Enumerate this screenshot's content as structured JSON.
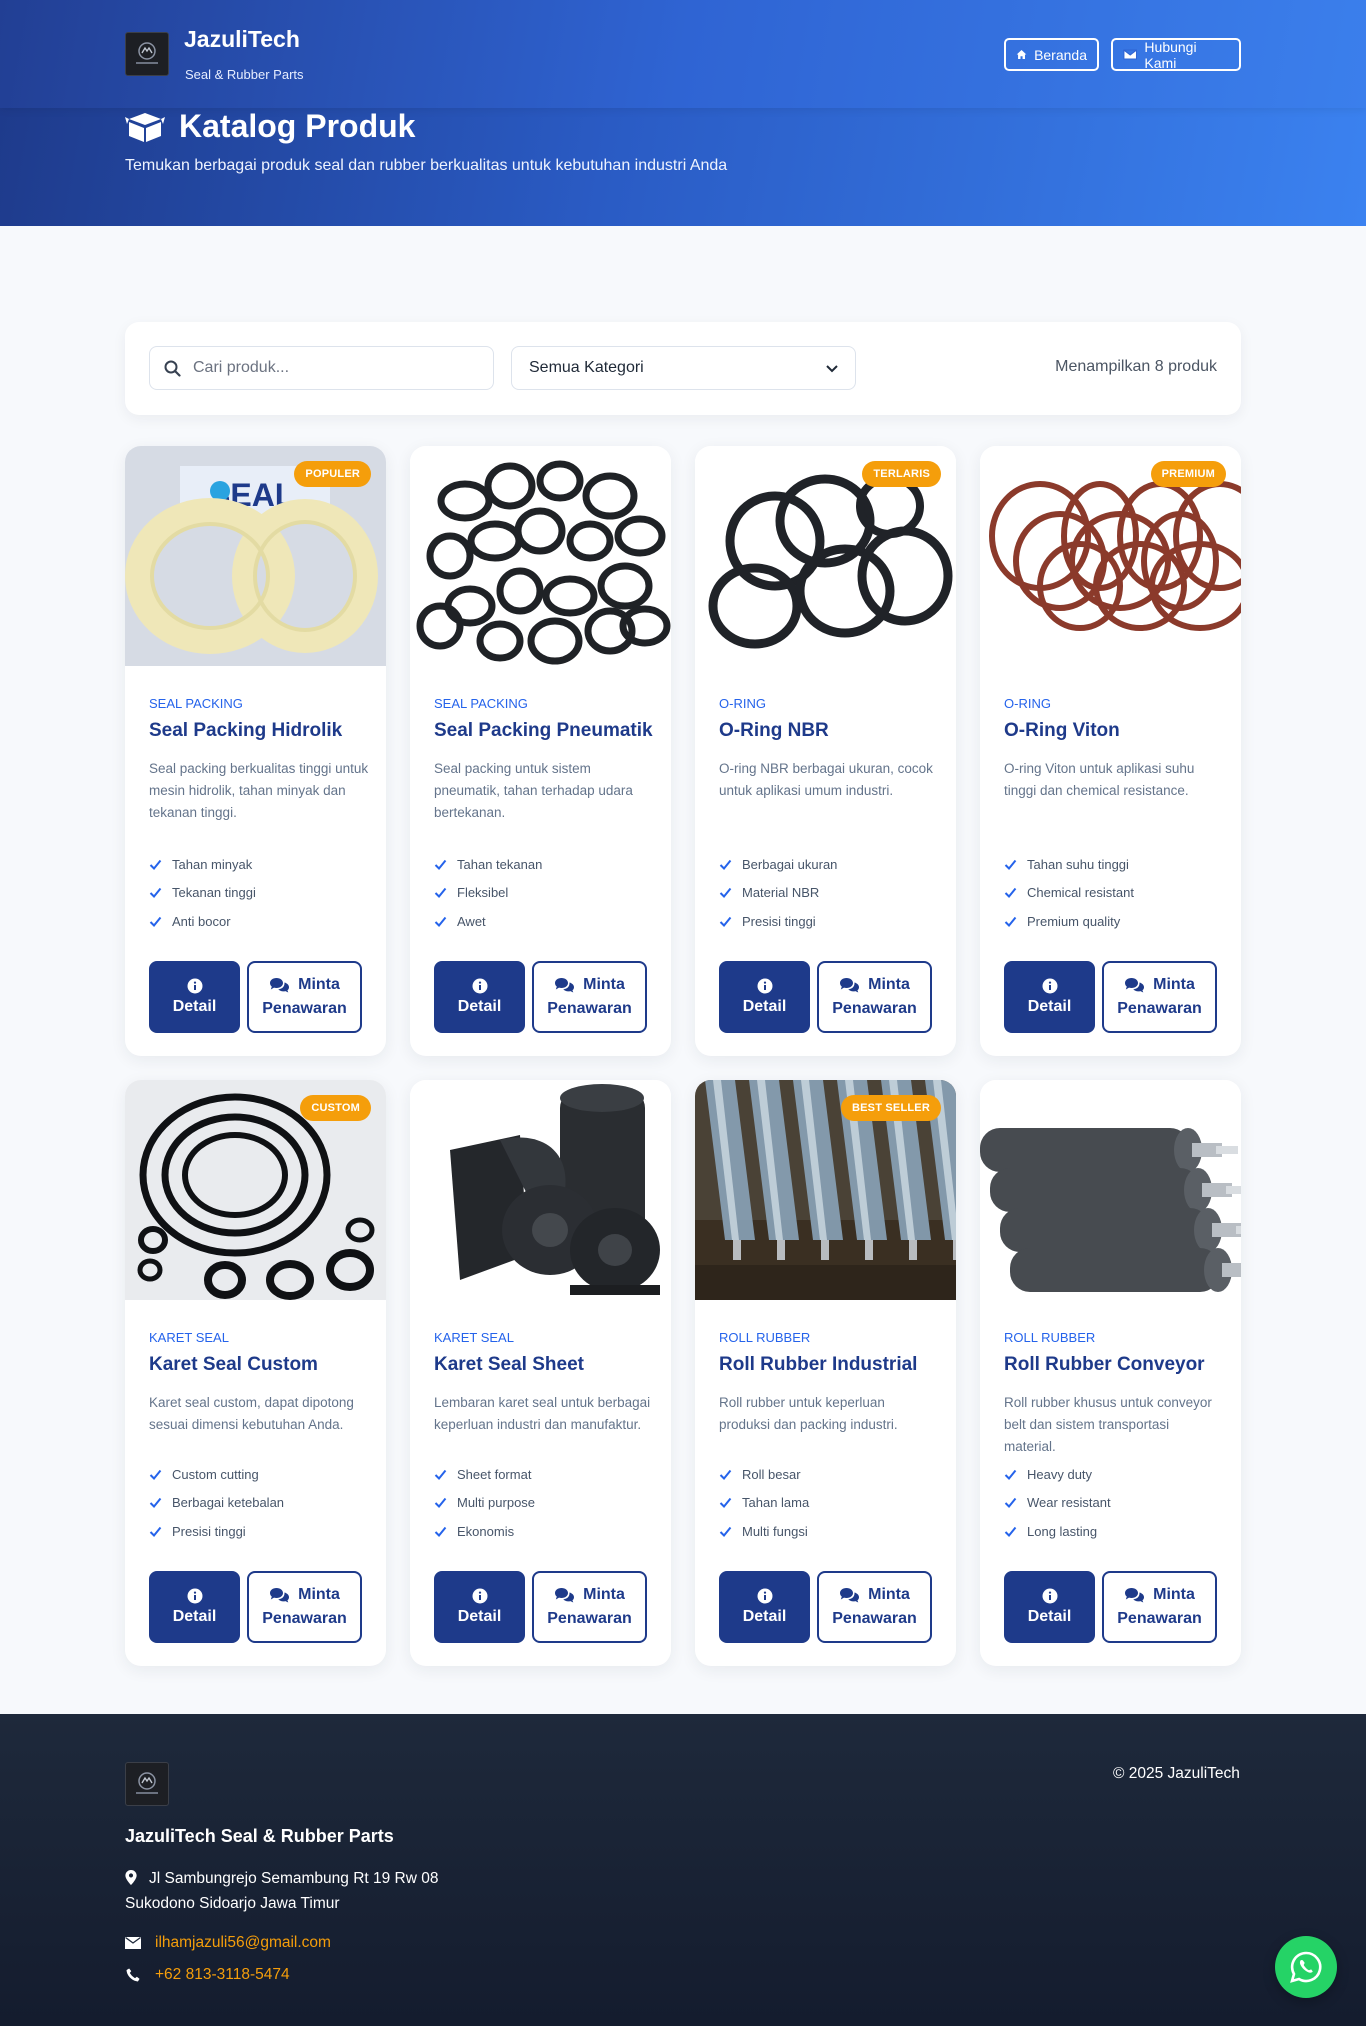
{
  "brand": {
    "name": "JazuliTech",
    "tagline": "Seal & Rubber Parts"
  },
  "nav": {
    "home_label": "Beranda",
    "contact_label": "Hubungi Kami"
  },
  "hero": {
    "title": "Katalog Produk",
    "subtitle": "Temukan berbagai produk seal dan rubber berkualitas untuk kebutuhan industri Anda"
  },
  "filter": {
    "search_placeholder": "Cari produk...",
    "category_selected": "Semua Kategori",
    "result_count": "Menampilkan 8 produk"
  },
  "buttons": {
    "detail": "Detail",
    "quote_line1": "Minta",
    "quote_line2": "Penawaran"
  },
  "products": [
    {
      "category": "SEAL PACKING",
      "name": "Seal Packing Hidrolik",
      "badge": "POPULER",
      "description": "Seal packing berkualitas tinggi untuk mesin hidrolik, tahan minyak dan tekanan tinggi.",
      "features": [
        "Tahan minyak",
        "Tekanan tinggi",
        "Anti bocor"
      ]
    },
    {
      "category": "SEAL PACKING",
      "name": "Seal Packing Pneumatik",
      "badge": "",
      "description": "Seal packing untuk sistem pneumatik, tahan terhadap udara bertekanan.",
      "features": [
        "Tahan tekanan",
        "Fleksibel",
        "Awet"
      ]
    },
    {
      "category": "O-RING",
      "name": "O-Ring NBR",
      "badge": "TERLARIS",
      "description": "O-ring NBR berbagai ukuran, cocok untuk aplikasi umum industri.",
      "features": [
        "Berbagai ukuran",
        "Material NBR",
        "Presisi tinggi"
      ]
    },
    {
      "category": "O-RING",
      "name": "O-Ring Viton",
      "badge": "PREMIUM",
      "description": "O-ring Viton untuk aplikasi suhu tinggi dan chemical resistance.",
      "features": [
        "Tahan suhu tinggi",
        "Chemical resistant",
        "Premium quality"
      ]
    },
    {
      "category": "KARET SEAL",
      "name": "Karet Seal Custom",
      "badge": "CUSTOM",
      "description": "Karet seal custom, dapat dipotong sesuai dimensi kebutuhan Anda.",
      "features": [
        "Custom cutting",
        "Berbagai ketebalan",
        "Presisi tinggi"
      ]
    },
    {
      "category": "KARET SEAL",
      "name": "Karet Seal Sheet",
      "badge": "",
      "description": "Lembaran karet seal untuk berbagai keperluan industri dan manufaktur.",
      "features": [
        "Sheet format",
        "Multi purpose",
        "Ekonomis"
      ]
    },
    {
      "category": "ROLL RUBBER",
      "name": "Roll Rubber Industrial",
      "badge": "BEST SELLER",
      "description": "Roll rubber untuk keperluan produksi dan packing industri.",
      "features": [
        "Roll besar",
        "Tahan lama",
        "Multi fungsi"
      ]
    },
    {
      "category": "ROLL RUBBER",
      "name": "Roll Rubber Conveyor",
      "badge": "",
      "description": "Roll rubber khusus untuk conveyor belt dan sistem transportasi material.",
      "features": [
        "Heavy duty",
        "Wear resistant",
        "Long lasting"
      ]
    }
  ],
  "footer": {
    "company": "JazuliTech Seal & Rubber Parts",
    "address_line1": "Jl Sambungrejo Semambung Rt 19 Rw 08",
    "address_line2": "Sukodono Sidoarjo Jawa Timur",
    "email": "ilhamjazuli56@gmail.com",
    "phone": "+62 813-3118-5474",
    "copyright": "© 2025 JazuliTech"
  },
  "logo_text": "JAZULITECH",
  "colors": {
    "primary": "#1e3a8a",
    "accent": "#2563eb",
    "badge": "#f59e0b",
    "whatsapp": "#25d366"
  },
  "icons": [
    "home-icon",
    "envelope-icon",
    "box-open-icon",
    "search-icon",
    "chevron-down-icon",
    "check-icon",
    "info-circle-icon",
    "comments-icon",
    "map-marker-icon",
    "phone-icon",
    "whatsapp-icon"
  ]
}
